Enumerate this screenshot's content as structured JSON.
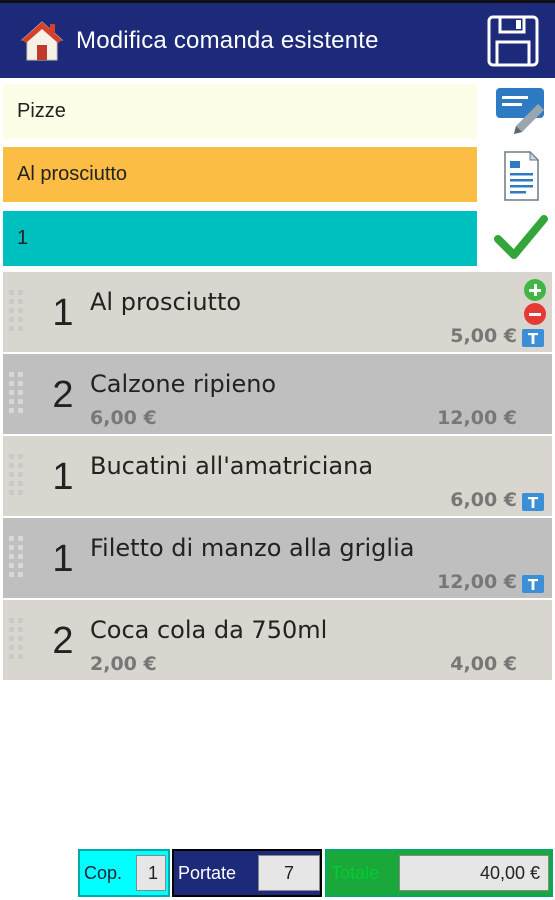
{
  "header": {
    "title": "Modifica comanda esistente",
    "icons": {
      "home": "home-icon",
      "save": "save-icon"
    }
  },
  "selectors": {
    "category": "Pizze",
    "product": "Al prosciutto",
    "quantity": "1",
    "icons": {
      "edit": "edit-note-icon",
      "document": "document-icon",
      "confirm": "checkmark-icon"
    }
  },
  "colors": {
    "header": "#1d2a7a",
    "category_bg": "#fefde8",
    "product_bg": "#fcbd45",
    "quantity_bg": "#00bfbf",
    "row_light": "#d9d6cf",
    "row_dark": "#bfbfbf",
    "plus": "#42b544",
    "minus": "#e53935"
  },
  "items": [
    {
      "qty": "1",
      "name": "Al prosciutto",
      "unit_price": "",
      "total": "5,00 €",
      "badge": "T",
      "has_controls": true
    },
    {
      "qty": "2",
      "name": "Calzone ripieno",
      "unit_price": "6,00 €",
      "total": "12,00 €",
      "badge": "",
      "has_controls": false
    },
    {
      "qty": "1",
      "name": "Bucatini all'amatriciana",
      "unit_price": "",
      "total": "6,00 €",
      "badge": "T",
      "has_controls": false
    },
    {
      "qty": "1",
      "name": "Filetto di manzo alla griglia",
      "unit_price": "",
      "total": "12,00 €",
      "badge": "T",
      "has_controls": false
    },
    {
      "qty": "2",
      "name": "Coca cola da 750ml",
      "unit_price": "2,00 €",
      "total": "4,00 €",
      "badge": "",
      "has_controls": false
    }
  ],
  "footer": {
    "coperti_label": "Cop.",
    "coperti_value": "1",
    "portate_label": "Portate",
    "portate_value": "7",
    "totale_label": "Totale",
    "totale_value": "40,00 €"
  }
}
